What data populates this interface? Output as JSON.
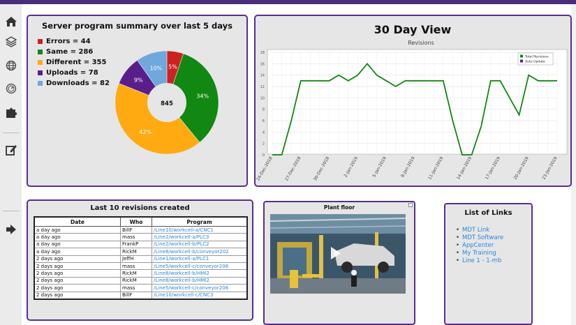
{
  "sidebar": {
    "items": [
      {
        "icon": "home-icon"
      },
      {
        "icon": "layers-icon"
      },
      {
        "icon": "globe-icon"
      },
      {
        "icon": "dashboard-icon"
      },
      {
        "icon": "puzzle-icon"
      },
      {
        "icon": "edit-icon"
      },
      {
        "icon": "sign-out-icon"
      }
    ]
  },
  "summary": {
    "title": "Server program summary over last 5 days",
    "legend": [
      {
        "label": "Errors = 44",
        "color": "#cc2222"
      },
      {
        "label": "Same = 286",
        "color": "#118811"
      },
      {
        "label": "Different = 355",
        "color": "#ffaa11"
      },
      {
        "label": "Uploads = 78",
        "color": "#5a1e8c"
      },
      {
        "label": "Downloads = 82",
        "color": "#6fa8dc"
      }
    ],
    "center_label": "845"
  },
  "chart_data": [
    {
      "type": "pie",
      "title": "Server program summary over last 5 days",
      "categories": [
        "Errors",
        "Same",
        "Different",
        "Uploads",
        "Downloads"
      ],
      "values": [
        44,
        286,
        355,
        78,
        82
      ],
      "total": 845,
      "data_labels": [
        "5%",
        "34%",
        "42%",
        "9%",
        "10%"
      ],
      "colors": [
        "#cc2222",
        "#118811",
        "#ffaa11",
        "#5a1e8c",
        "#6fa8dc"
      ]
    },
    {
      "type": "line",
      "title": "30 Day View",
      "subtitle": "Revisions",
      "x": [
        "24-Dec-2018",
        "25-Dec-2018",
        "26-Dec-2018",
        "27-Dec-2018",
        "28-Dec-2018",
        "29-Dec-2018",
        "30-Dec-2018",
        "31-Dec-2018",
        "1-Jan-2019",
        "2-Jan-2019",
        "3-Jan-2019",
        "4-Jan-2019",
        "5-Jan-2019",
        "6-Jan-2019",
        "7-Jan-2019",
        "8-Jan-2019",
        "9-Jan-2019",
        "10-Jan-2019",
        "11-Jan-2019",
        "12-Jan-2019",
        "13-Jan-2019",
        "14-Jan-2019",
        "15-Jan-2019",
        "16-Jan-2019",
        "17-Jan-2019",
        "18-Jan-2019",
        "19-Jan-2019",
        "20-Jan-2019",
        "21-Jan-2019",
        "22-Jan-2019",
        "23-Jan-2019"
      ],
      "x_tick_labels": [
        "24-Dec-2018",
        "27-Dec-2018",
        "30-Dec-2018",
        "2-Jan-2019",
        "5-Jan-2019",
        "8-Jan-2019",
        "11-Jan-2019",
        "14-Jan-2019",
        "17-Jan-2019",
        "20-Jan-2019",
        "23-Jan-2019"
      ],
      "series": [
        {
          "name": "Total Revisions",
          "color": "#118811",
          "values": [
            0,
            0,
            6,
            13,
            13,
            13,
            13,
            14,
            13,
            14,
            16,
            14,
            13,
            12,
            13,
            13,
            13,
            13,
            13,
            6,
            0,
            0,
            5,
            13,
            13,
            10,
            7,
            14,
            13,
            13,
            13
          ]
        },
        {
          "name": "Auto Update",
          "color": "#5a1e8c",
          "values": []
        }
      ],
      "y_ticks": [
        0,
        2,
        4,
        6,
        8,
        10,
        12,
        14,
        16,
        18
      ],
      "ylim": [
        0,
        18
      ],
      "legend_position": "top-right",
      "grid": true
    }
  ],
  "revisions": {
    "title": "Last 10 revisions created",
    "headers": [
      "Date",
      "Who",
      "Program"
    ],
    "rows": [
      [
        "a day ago",
        "BillF",
        "/Line10/workcell-a/CNC1"
      ],
      [
        "a day ago",
        "mass",
        "/Line2/workcell-a/PLC3"
      ],
      [
        "a day ago",
        "FrankP",
        "/Line2/workcell-b/PLC2"
      ],
      [
        "a day ago",
        "RickM",
        "/Line8/workcell-b/conveyor202"
      ],
      [
        "2 days ago",
        "JeffH",
        "/Line1/workcell-a/PLC1"
      ],
      [
        "2 days ago",
        "mass",
        "/Line5/workcell-c/conveyor206"
      ],
      [
        "2 days ago",
        "RickM",
        "/Line8/workcell-b/HMI2"
      ],
      [
        "2 days ago",
        "RickM",
        "/Line8/workcell-b/HMI2"
      ],
      [
        "2 days ago",
        "mass",
        "/Line5/workcell-c/conveyor206"
      ],
      [
        "2 days ago",
        "BillF",
        "/Line10/workcell-c/CNC3"
      ]
    ]
  },
  "plant": {
    "title": "Plant floor"
  },
  "links": {
    "title": "List of Links",
    "items": [
      "MDT Link",
      "MDT Software",
      "AppCenter",
      "My Training",
      "Line 1 - 1-mb"
    ]
  },
  "colors": {
    "accent": "#5a2d91",
    "link": "#2a86d6",
    "panel_bg": "#e6e6e6"
  }
}
